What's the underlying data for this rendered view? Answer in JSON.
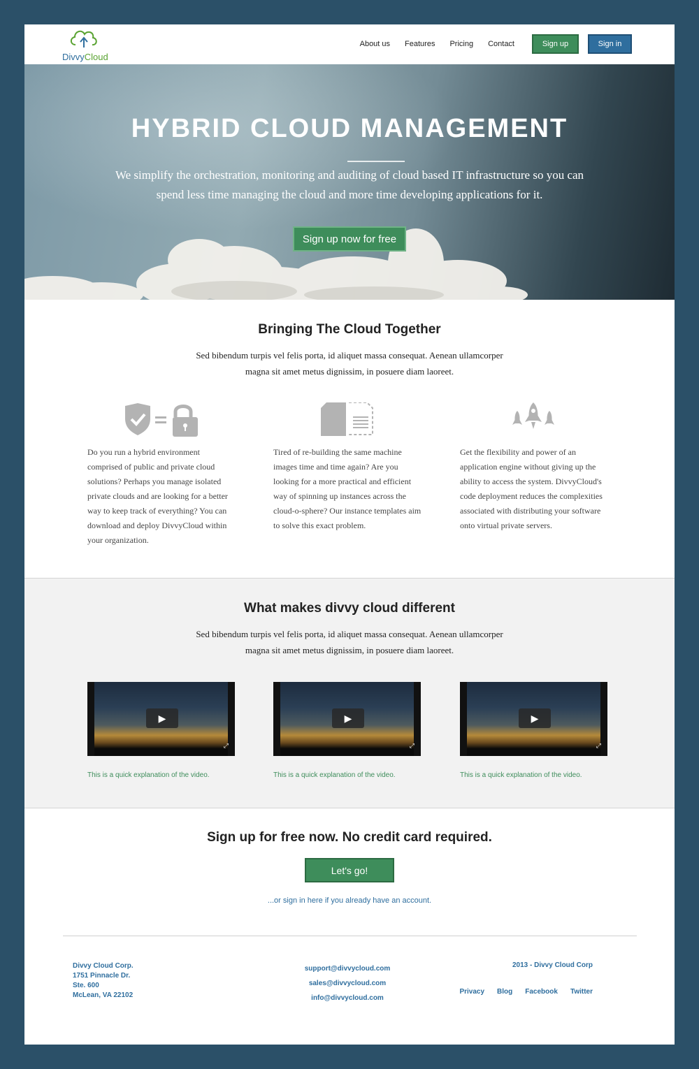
{
  "brand": {
    "name_part1": "Divvy",
    "name_part2": "Cloud",
    "color_blue": "#2f6e9e",
    "color_green": "#3e8d5b"
  },
  "nav": {
    "links": [
      "About us",
      "Features",
      "Pricing",
      "Contact"
    ],
    "signup_label": "Sign up",
    "signin_label": "Sign in"
  },
  "hero": {
    "title": "HYBRID CLOUD MANAGEMENT",
    "subtitle": "We simplify the orchestration, monitoring and auditing of cloud based IT infrastructure so you can spend less time managing the cloud and more time developing applications for it.",
    "cta_label": "Sign up now for free"
  },
  "features": {
    "title": "Bringing The Cloud Together",
    "intro": "Sed bibendum turpis vel felis porta, id aliquet massa consequat. Aenean ullamcorper magna sit amet metus dignissim, in posuere diam laoreet.",
    "items": [
      {
        "icon": "shield-lock-icon",
        "text": "Do you run a hybrid environment comprised of public and private cloud solutions? Perhaps you manage isolated private clouds and are looking for a better way to keep track of everything? You can download and deploy DivvyCloud within your organization."
      },
      {
        "icon": "document-copy-icon",
        "text": "Tired of re-building the same machine images time and time again? Are you looking for a more practical and efficient way of spinning up instances across the cloud-o-sphere? Our instance templates aim to solve this exact problem."
      },
      {
        "icon": "rockets-icon",
        "text": "Get the flexibility and power of an application engine without giving up the ability to access the system. DivvyCloud's code deployment reduces the complexities associated with distributing your software onto virtual private servers."
      }
    ]
  },
  "different": {
    "title": "What makes divvy cloud different",
    "intro": "Sed bibendum turpis vel felis porta, id aliquet massa consequat. Aenean ullamcorper magna sit amet metus dignissim, in posuere diam laoreet.",
    "videos": [
      {
        "caption": "This is a quick explanation of the video."
      },
      {
        "caption": "This is a quick explanation of the video."
      },
      {
        "caption": "This is a quick explanation of the video."
      }
    ]
  },
  "signup": {
    "title": "Sign up for free now. No credit card required.",
    "button_label": "Let's go!",
    "signin_link": "...or sign in here if you already have an account."
  },
  "footer": {
    "address": [
      "Divvy Cloud Corp.",
      "1751 Pinnacle Dr.",
      "Ste. 600",
      "McLean, VA 22102"
    ],
    "emails": [
      "support@divvycloud.com",
      "sales@divvycloud.com",
      "info@divvycloud.com"
    ],
    "copyright": "2013 - Divvy Cloud Corp",
    "links": [
      "Privacy",
      "Blog",
      "Facebook",
      "Twitter"
    ]
  }
}
